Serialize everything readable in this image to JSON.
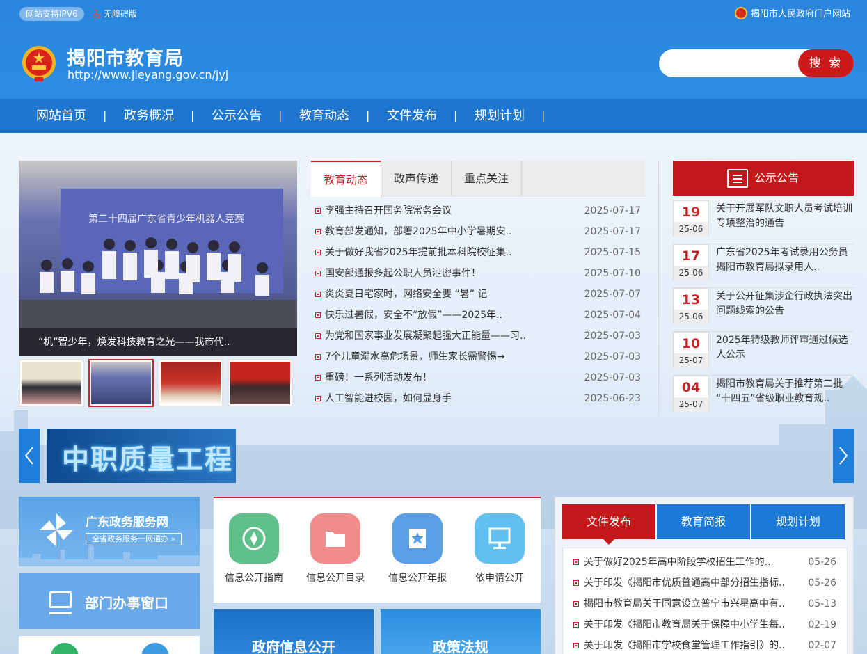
{
  "topbar": {
    "ipv6": "网站支持IPV6",
    "accessible": "无障碍版",
    "portal": "揭阳市人民政府门户网站"
  },
  "header": {
    "name": "揭阳市教育局",
    "url": "http://www.jieyang.gov.cn/jyj"
  },
  "search": {
    "placeholder": "",
    "button": "搜 索"
  },
  "nav": [
    "网站首页",
    "政务概况",
    "公示公告",
    "教育动态",
    "文件发布",
    "规划计划"
  ],
  "nav_sep": "|",
  "banner": {
    "caption": "“机”智少年，焕发科技教育之光——我市代..",
    "slide_text": "第二十四届广东省青少年机器人竞赛"
  },
  "news_tabs": [
    "教育动态",
    "政声传递",
    "重点关注"
  ],
  "news": [
    {
      "title": "李强主持召开国务院常务会议",
      "date": "2025-07-17"
    },
    {
      "title": "教育部发通知，部署2025年中小学暑期安..",
      "date": "2025-07-17"
    },
    {
      "title": "关于做好我省2025年提前批本科院校征集..",
      "date": "2025-07-15"
    },
    {
      "title": "国安部通报多起公职人员泄密事件！",
      "date": "2025-07-10"
    },
    {
      "title": "炎炎夏日宅家时，网络安全要 “暑” 记",
      "date": "2025-07-07"
    },
    {
      "title": "快乐过暑假，安全不“放假”——2025年..",
      "date": "2025-07-04"
    },
    {
      "title": "为党和国家事业发展凝聚起强大正能量——习..",
      "date": "2025-07-03"
    },
    {
      "title": "7个儿童溺水高危场景，师生家长需警惕→",
      "date": "2025-07-03"
    },
    {
      "title": "重磅！一系列活动发布！",
      "date": "2025-07-03"
    },
    {
      "title": "人工智能进校园，如何显身手",
      "date": "2025-06-23"
    }
  ],
  "notice_title": "公示公告",
  "notices": [
    {
      "day": "19",
      "month": "25-06",
      "title": "关于开展军队文职人员考试培训专项整治的通告"
    },
    {
      "day": "17",
      "month": "25-06",
      "title": "广东省2025年考试录用公务员揭阳市教育局拟录用人.."
    },
    {
      "day": "13",
      "month": "25-06",
      "title": "关于公开征集涉企行政执法突出问题线索的公告"
    },
    {
      "day": "10",
      "month": "25-07",
      "title": "2025年特级教师评审通过候选人公示"
    },
    {
      "day": "04",
      "month": "25-07",
      "title": "揭阳市教育局关于推荐第二批 “十四五”省级职业教育规.."
    }
  ],
  "promo": "中职质量工程",
  "gdzw": {
    "title": "广东政务服务网",
    "sub": "全省政务服务一网通办 »"
  },
  "bmbs": "部门办事窗口",
  "services": [
    {
      "label": "信息公开指南",
      "color": "#5fc08b",
      "icon": "compass-icon"
    },
    {
      "label": "信息公开目录",
      "color": "#f08c8c",
      "icon": "folder-icon"
    },
    {
      "label": "信息公开年报",
      "color": "#5b9fe6",
      "icon": "star-icon"
    },
    {
      "label": "依申请公开",
      "color": "#62c0ee",
      "icon": "monitor-icon"
    }
  ],
  "zfxx": "政府信息公开",
  "zcfg": "政策法规",
  "doc_tabs": [
    "文件发布",
    "教育简报",
    "规划计划"
  ],
  "docs": [
    {
      "title": "关于做好2025年高中阶段学校招生工作的..",
      "date": "05-26"
    },
    {
      "title": "关于印发《揭阳市优质普通高中部分招生指标..",
      "date": "05-26"
    },
    {
      "title": "揭阳市教育局关于同意设立普宁市兴星高中有..",
      "date": "05-13"
    },
    {
      "title": "关于印发《揭阳市教育局关于保障中小学生每..",
      "date": "02-19"
    },
    {
      "title": "关于印发《揭阳市学校食堂管理工作指引》的..",
      "date": "02-07"
    }
  ]
}
